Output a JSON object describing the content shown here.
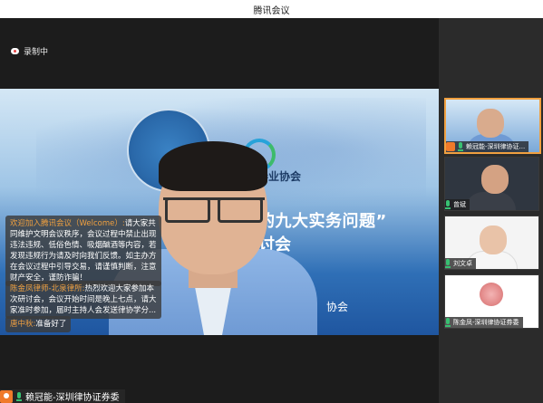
{
  "window": {
    "title": "腾讯会议"
  },
  "status": {
    "recording_label": "录制中"
  },
  "slide": {
    "association": "证券业协会",
    "headline_line1": "的九大实务问题”",
    "headline_line2": "讨会",
    "association_bottom": "协会"
  },
  "chat": [
    {
      "name": "欢迎加入腾讯会议（Welcome）:",
      "text": "请大家共同维护文明会议秩序，会议过程中禁止出现违法违规、低俗色情、吸烟酗酒等内容，若发现违规行为请及时向我们反馈。如主办方在会议过程中引导交易，请谨慎判断，注意财产安全，谨防诈骗！"
    },
    {
      "name": "陈金凤律师-北泉律所:",
      "text": "热烈欢迎大家参加本次研讨会，会议开始时间是晚上七点，请大家准时参加，届时主持人会发送律协学分..."
    },
    {
      "name": "唐中秋:",
      "text": "准备好了"
    }
  ],
  "main_speaker": {
    "name": "赖冠能-深圳律协证券委"
  },
  "participants": [
    {
      "name": "赖冠能-深圳律协证...",
      "active": true
    },
    {
      "name": "曾斌"
    },
    {
      "name": "刘文卓"
    },
    {
      "name": "陈金凤-深圳律协证券委"
    }
  ],
  "colors": {
    "accent": "#f0a040",
    "mic": "#38c172",
    "avatar": "#f07a2a"
  }
}
